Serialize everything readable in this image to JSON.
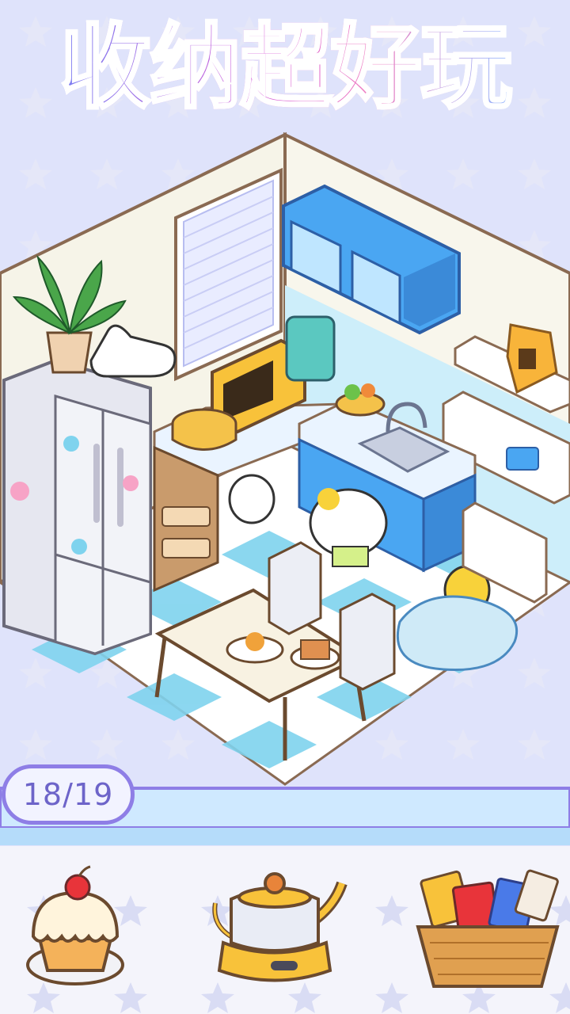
{
  "game": {
    "title": "收纳超好玩",
    "progress": {
      "current": 18,
      "total": 19,
      "label": "18/19"
    },
    "tray": {
      "items": [
        {
          "name": "cupcake"
        },
        {
          "name": "teapot"
        },
        {
          "name": "snack-basket"
        }
      ]
    }
  },
  "colors": {
    "background": "#dfe3fb",
    "wall": "#f6f4e8",
    "floor_light": "#ffffff",
    "floor_blue": "#7fd3ee",
    "cabinet_blue": "#4aa6f2",
    "counter": "#eaf4ff",
    "fridge": "#e6e7f0",
    "tray_bar": "#cfe9ff",
    "pill_border": "#8e7ee6"
  }
}
